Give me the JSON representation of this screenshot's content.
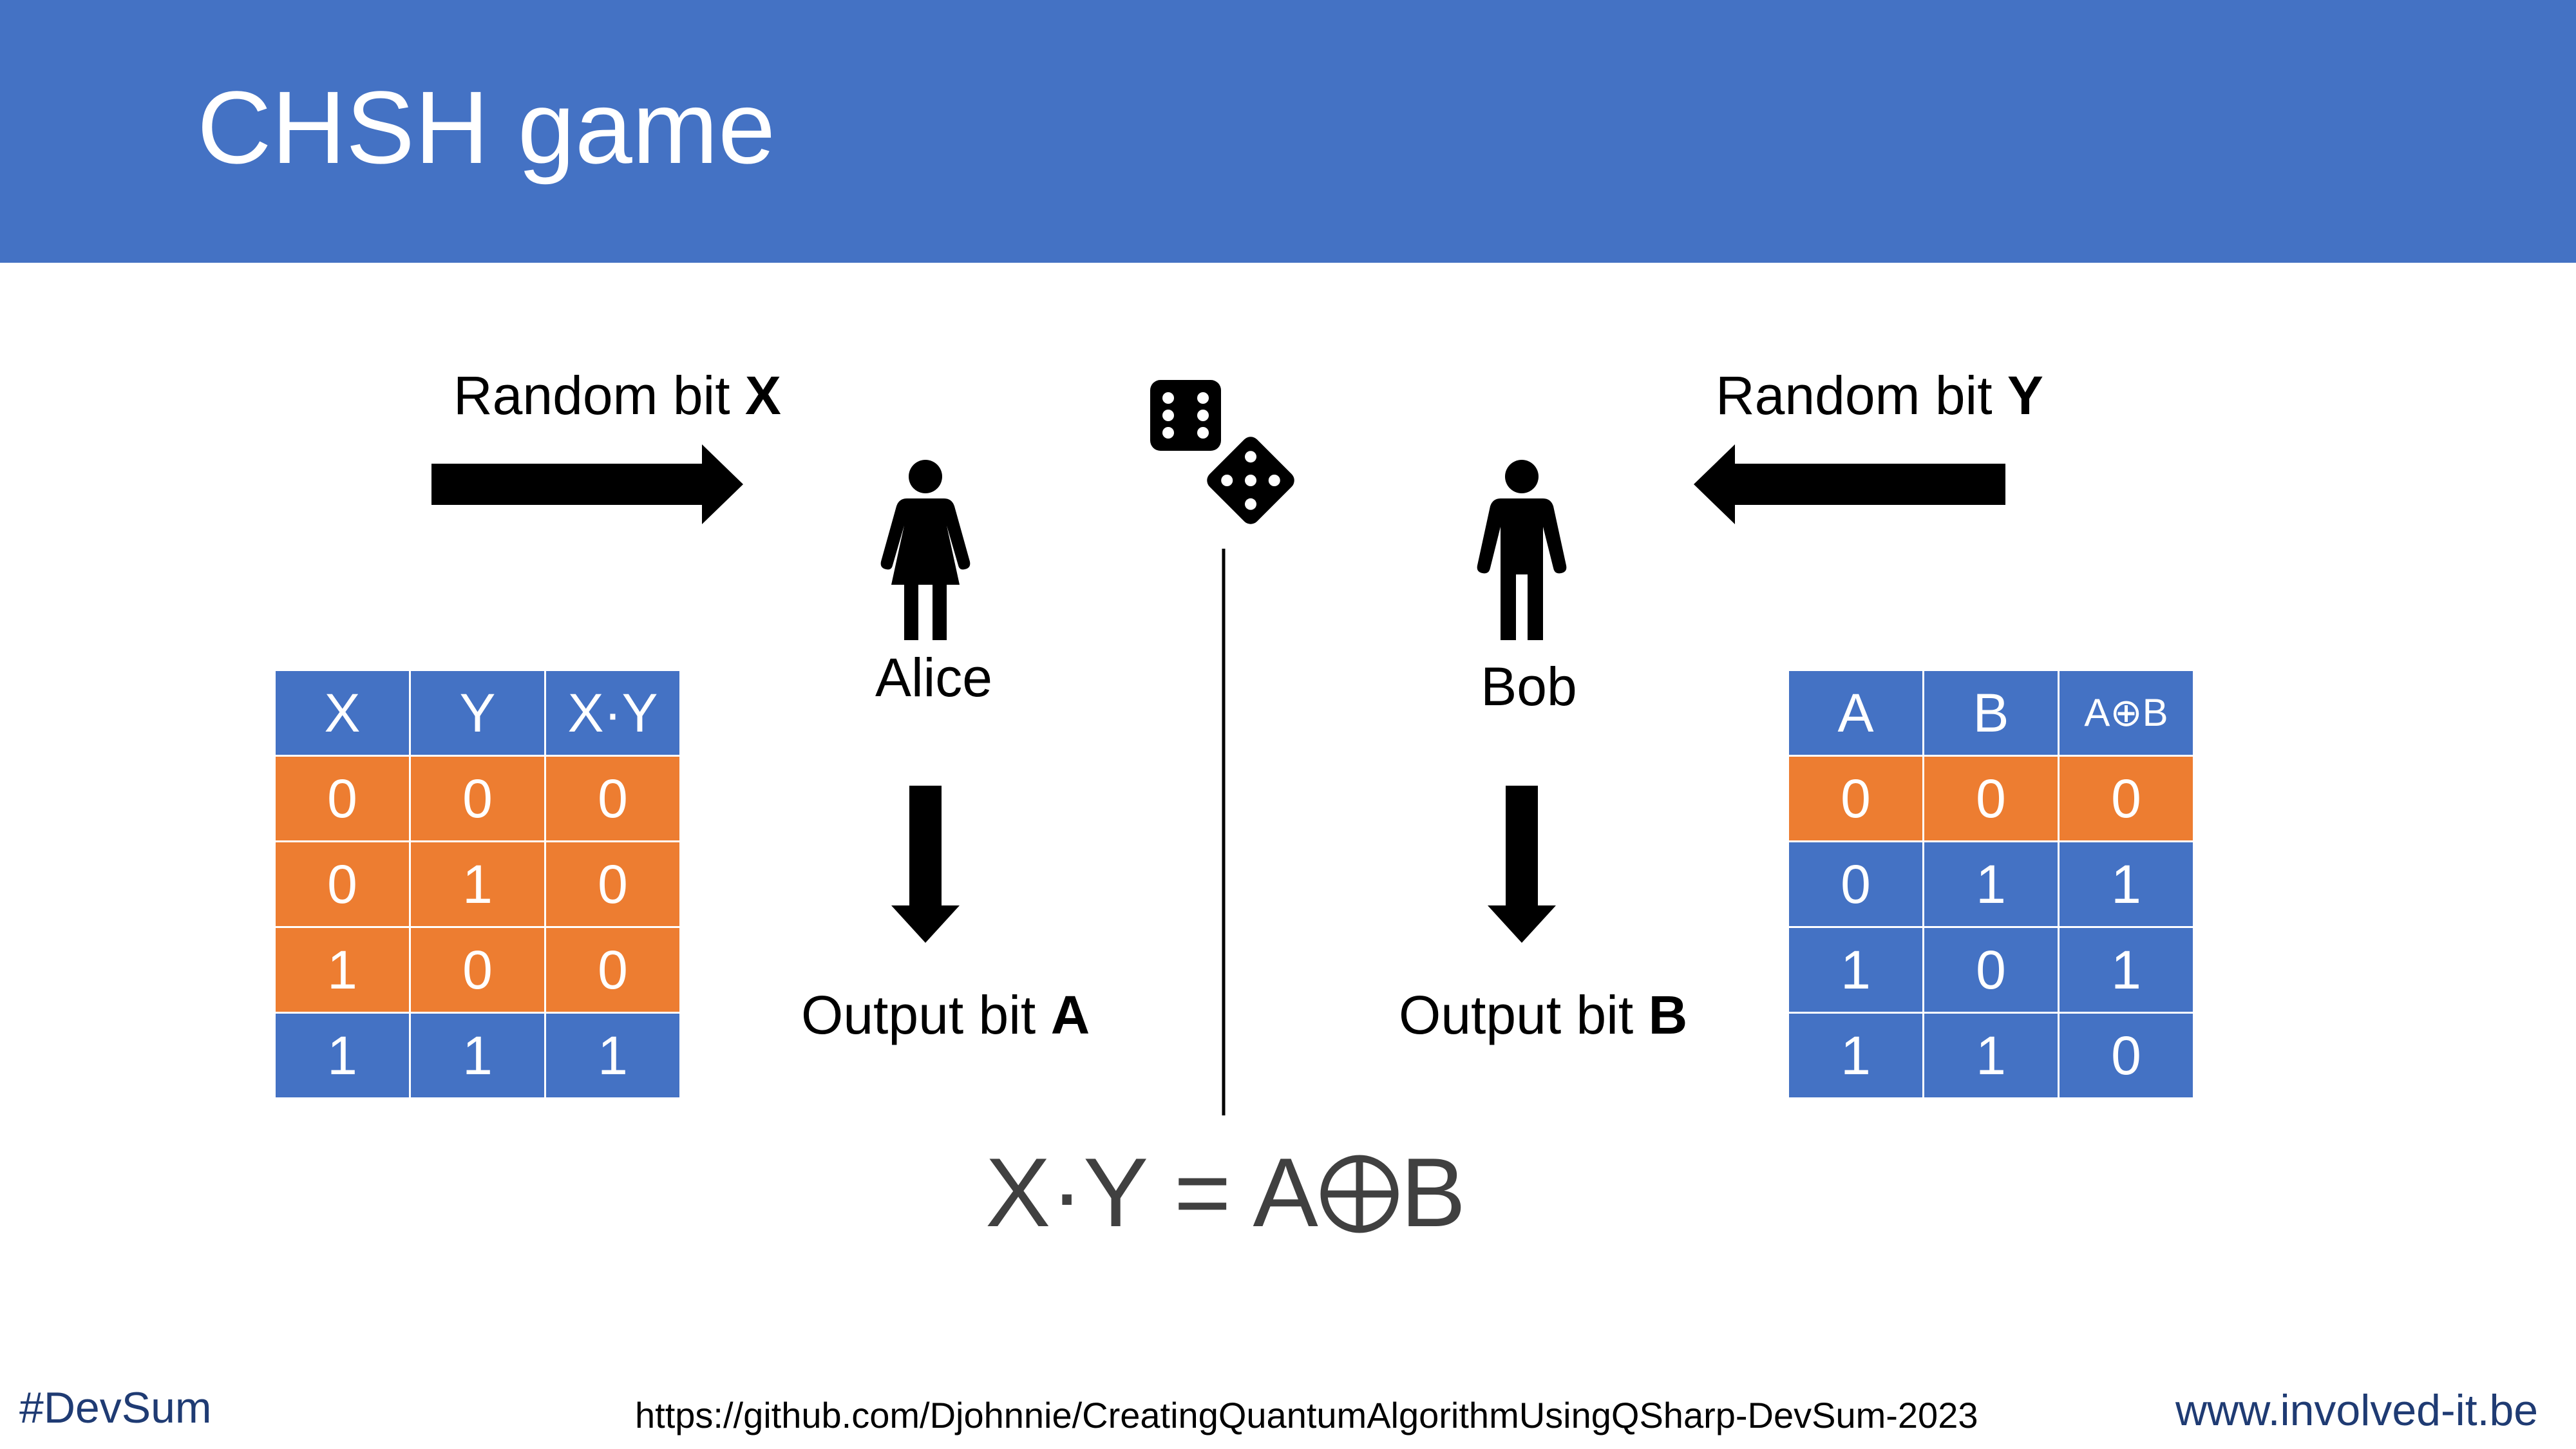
{
  "header": {
    "title": "CHSH game"
  },
  "left_input": {
    "text": "Random bit ",
    "var": "X"
  },
  "right_input": {
    "text": "Random bit ",
    "var": "Y"
  },
  "alice": {
    "name": "Alice",
    "output_text": "Output bit ",
    "output_var": "A"
  },
  "bob": {
    "name": "Bob",
    "output_text": "Output bit ",
    "output_var": "B"
  },
  "formula": {
    "left": "X·Y = A",
    "right": "B"
  },
  "table_left": {
    "headers": [
      "X",
      "Y",
      "X·Y"
    ],
    "rows": [
      [
        "0",
        "0",
        "0"
      ],
      [
        "0",
        "1",
        "0"
      ],
      [
        "1",
        "0",
        "0"
      ],
      [
        "1",
        "1",
        "1"
      ]
    ],
    "row_colors": [
      "orange",
      "orange",
      "orange",
      "blue"
    ]
  },
  "table_right": {
    "headers": [
      "A",
      "B",
      "A⊕B"
    ],
    "rows": [
      [
        "0",
        "0",
        "0"
      ],
      [
        "0",
        "1",
        "1"
      ],
      [
        "1",
        "0",
        "1"
      ],
      [
        "1",
        "1",
        "0"
      ]
    ],
    "row_colors": [
      "orange",
      "blue",
      "blue",
      "blue"
    ]
  },
  "footer": {
    "hashtag": "#DevSum",
    "url": "https://github.com/Djohnnie/CreatingQuantumAlgorithmUsingQSharp-DevSum-2023",
    "site": "www.involved-it.be"
  },
  "colors": {
    "brand_blue": "#4472c4",
    "accent_orange": "#ed7d31",
    "text_gray": "#404040",
    "footer_navy": "#1f3b73"
  },
  "icons": [
    "dice-icon",
    "woman-icon",
    "man-icon",
    "arrow-right-icon",
    "arrow-left-icon",
    "arrow-down-icon",
    "xor-symbol-icon"
  ]
}
